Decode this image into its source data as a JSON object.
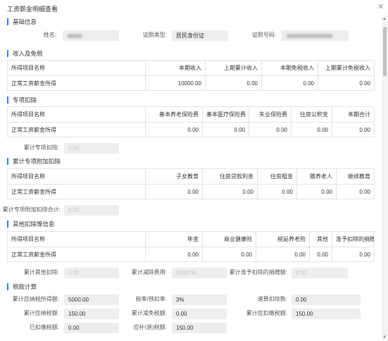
{
  "dialog": {
    "title": "工资薪金明细查看"
  },
  "basic": {
    "title": "基础信息",
    "name_label": "姓名:",
    "id_type_label": "证照类型:",
    "id_type_value": "居民身份证",
    "id_no_label": "证照号码:"
  },
  "income": {
    "title": "收入及免税",
    "headers": [
      "所得项目名称",
      "本期收入",
      "上期累计收入",
      "本期免税收入",
      "上期累计免税收入"
    ],
    "row": [
      "正常工资薪金所得",
      "10000.00",
      "0.00",
      "0.00",
      "0.00"
    ]
  },
  "special": {
    "title": "专项扣除",
    "headers": [
      "所得项目名称",
      "基本养老保险费",
      "基本医疗保险费",
      "失业保险费",
      "住房公积金",
      "本期合计"
    ],
    "row": [
      "正常工资薪金所得",
      "0.00",
      "0.00",
      "0.00",
      "0.00",
      "0.00"
    ],
    "total_label": "累计专项扣除:",
    "total_value": "0.00"
  },
  "additional": {
    "title": "累计专项附加扣除",
    "headers": [
      "所得项目名称",
      "子女教育",
      "住房贷款利息",
      "住房租金",
      "赡养老人",
      "继续教育"
    ],
    "row": [
      "正常工资薪金所得",
      "0.00",
      "0.00",
      "0.00",
      "0.00",
      "0.00"
    ],
    "total_label": "累计专项附加扣除合计:",
    "total_value": "0.00"
  },
  "other": {
    "title": "其他扣除等信息",
    "headers": [
      "所得项目名称",
      "年金",
      "商业健康险",
      "税延养老险",
      "其他",
      "准予扣除的捐赠额"
    ],
    "row": [
      "正常工资薪金所得",
      "0.00",
      "0.00",
      "0.00",
      "0.00",
      "0.00"
    ],
    "other_label": "累计其他扣除:",
    "other_value": "0.00",
    "deduct_label": "累计减除费用:",
    "deduct_value": "5000.00",
    "donation_label": "累计准予扣除的捐赠额:",
    "donation_value": "0.00"
  },
  "tax": {
    "title": "税款计算",
    "taxable_label": "累计应纳税所得额:",
    "taxable_value": "5000.00",
    "rate_label": "税率/预扣率:",
    "rate_value": "3%",
    "quick_label": "速算扣除数:",
    "quick_value": "0.00",
    "payable_label": "累计应纳税额:",
    "payable_value": "150.00",
    "reduce_label": "累计减免税额:",
    "reduce_value": "0.00",
    "withhold_label": "累计应扣缴税额:",
    "withhold_value": "150.00",
    "paid_label": "已扣缴税额:",
    "paid_value": "0.00",
    "refund_label": "应补(退)税额:",
    "refund_value": "150.00"
  }
}
